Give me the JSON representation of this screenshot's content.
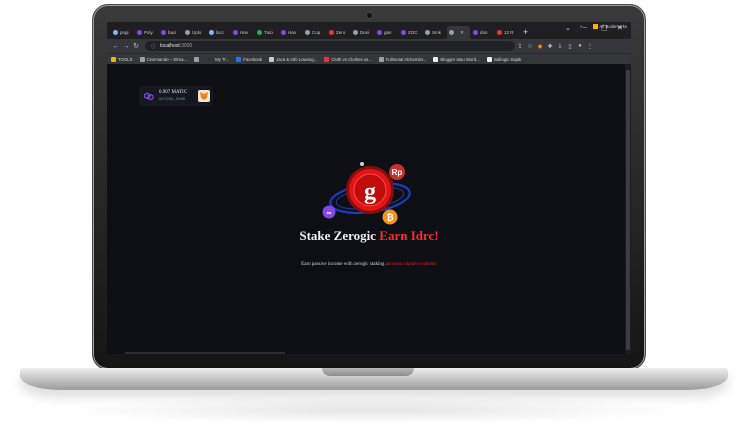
{
  "tabs": [
    {
      "label": "pngi",
      "color": "#8ab4f8",
      "active": false
    },
    {
      "label": "Poly",
      "color": "#8247e5",
      "active": false
    },
    {
      "label": "baci",
      "color": "#8247e5",
      "active": false
    },
    {
      "label": "Uplo",
      "color": "#9aa0a6",
      "active": false
    },
    {
      "label": "locc",
      "color": "#8ab4f8",
      "active": false
    },
    {
      "label": "Hav",
      "color": "#8247e5",
      "active": false
    },
    {
      "label": "Tuto",
      "color": "#34a853",
      "active": false
    },
    {
      "label": "Has",
      "color": "#8247e5",
      "active": false
    },
    {
      "label": "Cop",
      "color": "#9aa0a6",
      "active": false
    },
    {
      "label": "Zero",
      "color": "#e53935",
      "active": false
    },
    {
      "label": "Desi",
      "color": "#9aa0a6",
      "active": false
    },
    {
      "label": "gan",
      "color": "#8247e5",
      "active": false
    },
    {
      "label": "ZOC",
      "color": "#8247e5",
      "active": false
    },
    {
      "label": "Smk",
      "color": "#9aa0a6",
      "active": false
    },
    {
      "label": "",
      "color": "#9aa0a6",
      "active": true
    },
    {
      "label": "don",
      "color": "#8247e5",
      "active": false
    },
    {
      "label": "12 R",
      "color": "#e53935",
      "active": false
    }
  ],
  "window_controls": {
    "dropdown": "⌄",
    "minimize": "–",
    "maximize": "▢",
    "close": "✕"
  },
  "toolbar": {
    "back": "←",
    "forward": "→",
    "reload": "↻",
    "info": "ⓘ",
    "url_host": "localhost",
    "url_port": ":3000"
  },
  "bookmarks": [
    {
      "label": "TOOLS",
      "color": "#f4b400"
    },
    {
      "label": "Cinemando – Strea...",
      "color": "#9aa0a6"
    },
    {
      "label": "",
      "color": "#9aa0a6"
    },
    {
      "label": "My Tr...",
      "color": "#333333"
    },
    {
      "label": "Facebook",
      "color": "#1877f2"
    },
    {
      "label": "Jaca & Info Lowong...",
      "color": "#cccccc"
    },
    {
      "label": "Cloth vs Clothes vs...",
      "color": "#e53935"
    },
    {
      "label": "Fullmetal Alchemist...",
      "color": "#9aa0a6"
    },
    {
      "label": "Blogger atau Word...",
      "color": "#eeeeee"
    },
    {
      "label": "indilogic Sajak",
      "color": "#eeeeee"
    }
  ],
  "bookmarks_more": "»",
  "all_bookmarks": "All Bookmarks",
  "wallet": {
    "balance": "0.907 MATIC",
    "address": "0x7C56...5496"
  },
  "hero": {
    "title_white": "Stake Zerogic",
    "title_red": "Earn Idrc!",
    "subtitle_white": "Earn passive income with zerogic staking",
    "subtitle_red": "and earn rupiah-x tokens!"
  },
  "colors": {
    "accent_red": "#ff2b2b",
    "bg": "#0d0f14",
    "polygon": "#8247e5",
    "bitcoin": "#f7931a"
  }
}
